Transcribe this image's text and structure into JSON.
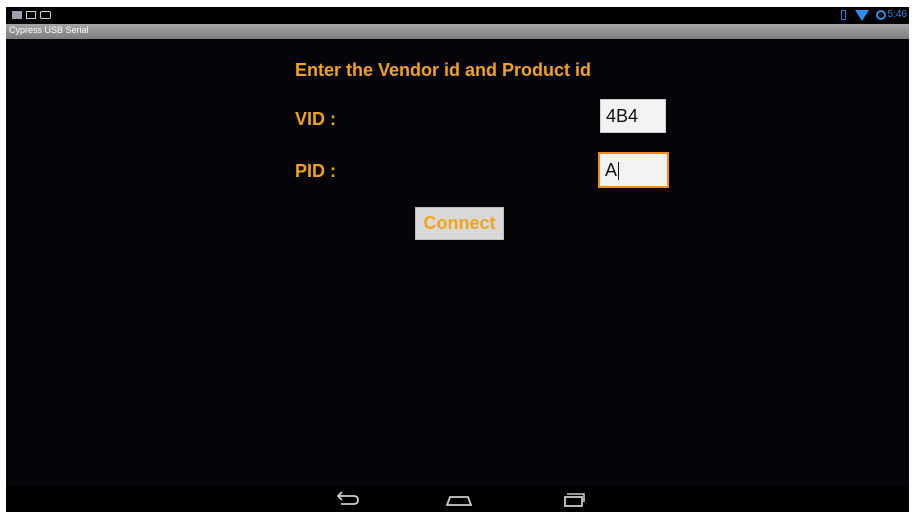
{
  "status_bar": {
    "clock": "5:46",
    "icons": {
      "notifications": [
        "image-icon",
        "screen-icon",
        "usb-icon"
      ],
      "system": [
        "battery-icon",
        "wifi-icon",
        "alarm-icon"
      ]
    },
    "accent_color": "#2a8ff0"
  },
  "app": {
    "title": "Cypress USB Serial"
  },
  "form": {
    "heading": "Enter the Vendor id and Product id",
    "vid_label": "VID :",
    "vid_value": "4B4",
    "pid_label": "PID :",
    "pid_value": "A",
    "connect_label": "Connect",
    "label_color": "#f2a31c",
    "focus_color": "#f08c1a"
  },
  "nav_bar": {
    "icons": [
      "back-icon",
      "home-icon",
      "recents-icon"
    ]
  }
}
